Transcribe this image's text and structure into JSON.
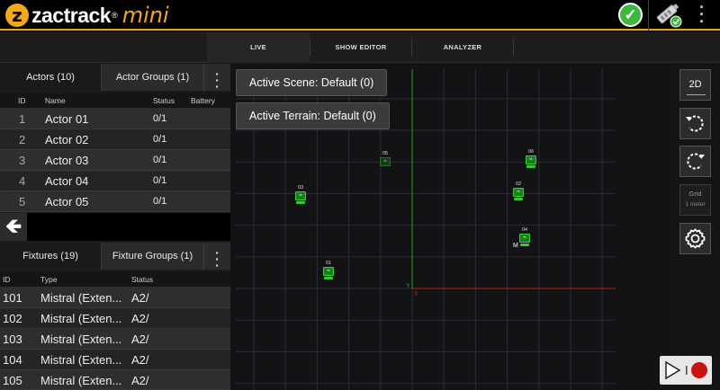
{
  "brand": {
    "name": "zactrack",
    "reg": "®",
    "edition": "mini",
    "logo_glyph": "z"
  },
  "colors": {
    "accent": "#e8a21a",
    "ok": "#3cb83c",
    "actor": "#188018",
    "axis_y": "#1fa01f",
    "axis_x": "#b02020",
    "record": "#cc1111"
  },
  "top": {
    "status_icon": "check-icon",
    "device_icon": "device-connected-icon",
    "menu_icon": "kebab-menu-icon"
  },
  "nav": {
    "tabs": [
      {
        "label": "LIVE",
        "active": true
      },
      {
        "label": "SHOW EDITOR",
        "active": false
      },
      {
        "label": "ANALYZER",
        "active": false
      }
    ]
  },
  "actors_panel": {
    "tabs": [
      {
        "label": "Actors (10)",
        "active": true
      },
      {
        "label": "Actor Groups (1)",
        "active": false
      }
    ],
    "columns": {
      "id": "ID",
      "name": "Name",
      "status": "Status",
      "battery": "Battery"
    },
    "rows": [
      {
        "id": "1",
        "name": "Actor 01",
        "status": "0/1",
        "battery": ""
      },
      {
        "id": "2",
        "name": "Actor 02",
        "status": "0/1",
        "battery": ""
      },
      {
        "id": "3",
        "name": "Actor 03",
        "status": "0/1",
        "battery": ""
      },
      {
        "id": "4",
        "name": "Actor 04",
        "status": "0/1",
        "battery": ""
      },
      {
        "id": "5",
        "name": "Actor 05",
        "status": "0/1",
        "battery": ""
      }
    ]
  },
  "fixtures_panel": {
    "tabs": [
      {
        "label": "Fixtures (19)",
        "active": true
      },
      {
        "label": "Fixture Groups (1)",
        "active": false
      }
    ],
    "columns": {
      "id": "ID",
      "type": "Type",
      "status": "Status"
    },
    "rows": [
      {
        "id": "101",
        "type": "Mistral (Exten...",
        "status": "A2/"
      },
      {
        "id": "102",
        "type": "Mistral (Exten...",
        "status": "A2/"
      },
      {
        "id": "103",
        "type": "Mistral (Exten...",
        "status": "A2/"
      },
      {
        "id": "104",
        "type": "Mistral (Exten...",
        "status": "A2/"
      },
      {
        "id": "105",
        "type": "Mistral (Exten...",
        "status": "A2/"
      }
    ]
  },
  "scene": {
    "active_scene": "Active Scene: Default (0)",
    "active_terrain": "Active Terrain: Default (0)"
  },
  "axes": {
    "y_label": "Y",
    "x_label": "X"
  },
  "grid_markers": [
    {
      "label": "05",
      "note": ""
    },
    {
      "label": "06",
      "note": ""
    },
    {
      "label": "03",
      "note": ""
    },
    {
      "label": "02",
      "note": ""
    },
    {
      "label": "04",
      "note": "M"
    },
    {
      "label": "01",
      "note": ""
    }
  ],
  "toolbar": {
    "view_mode": "2D",
    "rotate_left_icon": "rotate-left-icon",
    "rotate_right_icon": "rotate-right-icon",
    "grid_label": "Grid",
    "grid_size": "1 meter",
    "settings_icon": "gear-icon",
    "play_icon": "play-icon",
    "record_icon": "record-icon"
  }
}
